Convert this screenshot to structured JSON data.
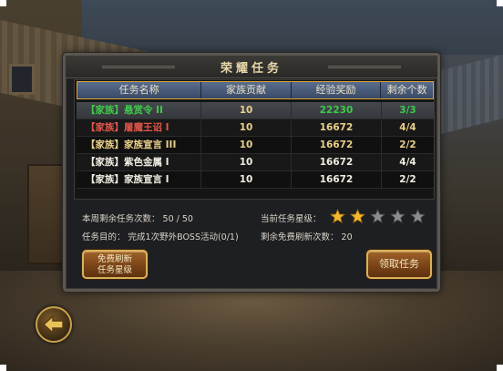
{
  "panel": {
    "title": "荣耀任务"
  },
  "table": {
    "headers": [
      "任务名称",
      "家族贡献",
      "经验奖励",
      "剩余个数"
    ],
    "rows": [
      {
        "name": "【家族】悬赏令 II",
        "contribution": "10",
        "exp": "22230",
        "remaining": "3/3",
        "color": "#3fc94a",
        "selected": true
      },
      {
        "name": "【家族】屠魔王诏 I",
        "contribution": "10",
        "exp": "16672",
        "remaining": "4/4",
        "color": "#e2564b",
        "selected": false
      },
      {
        "name": "【家族】家族宣言 III",
        "contribution": "10",
        "exp": "16672",
        "remaining": "2/2",
        "color": "#e9d089",
        "selected": false
      },
      {
        "name": "【家族】紫色金属 I",
        "contribution": "10",
        "exp": "16672",
        "remaining": "4/4",
        "color": "#f0ece0",
        "selected": false
      },
      {
        "name": "【家族】家族宣言 I",
        "contribution": "10",
        "exp": "16672",
        "remaining": "2/2",
        "color": "#f0ece0",
        "selected": false
      }
    ]
  },
  "info": {
    "weekly_label": "本周剩余任务次数：",
    "weekly_value": "50 / 50",
    "goal_label": "任务目的：",
    "goal_value": "完成1次野外BOSS活动(0/1)",
    "star_label": "当前任务星级：",
    "stars_filled": 2,
    "stars_total": 5,
    "free_refresh_label": "剩余免费刷新次数：",
    "free_refresh_value": "20"
  },
  "buttons": {
    "refresh_line1": "免费刷新",
    "refresh_line2": "任务星级",
    "claim": "领取任务"
  },
  "colors": {
    "accent_gold": "#d9a233",
    "header_blue": "#394a66",
    "button_brown": "#7a4417"
  }
}
